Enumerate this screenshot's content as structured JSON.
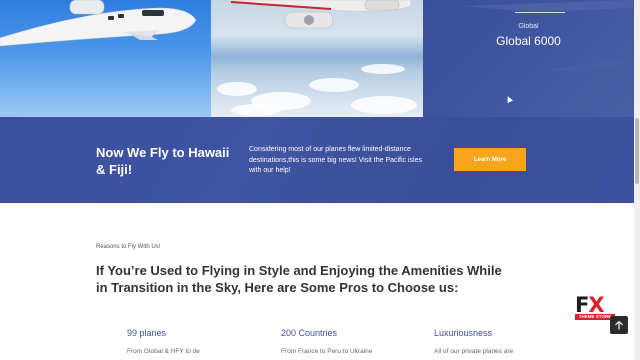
{
  "hero_panels": {
    "panel3_kicker": "Global",
    "panel3_title": "Global 6000"
  },
  "promo": {
    "heading": "Now We Fly to Hawaii & Fiji!",
    "text": "Considering most of our planes flew limited-distance destinations,this is some big news! Visit the Pacific isles with our help!",
    "button_label": "Learn More"
  },
  "reasons": {
    "kicker": "Reasons to Fly With Us!",
    "heading": "If You’re Used to Flying in Style and Enjoying the Amenities While in Transition in the Sky, Here are Some Pros to Choose us:",
    "features": [
      {
        "title": "99 planes",
        "desc": "From Global & HFY to de"
      },
      {
        "title": "200 Countries",
        "desc": "From France to Peru to Ukraine"
      },
      {
        "title": "Luxuriousness",
        "desc": "All of our private planes are"
      }
    ]
  },
  "logo": {
    "letters_f": "F",
    "letters_x": "X",
    "tagline": "THEME STORE"
  },
  "icons": {
    "back_to_top": "arrow-up-icon"
  },
  "colors": {
    "promo_bg": "#3c4f9e",
    "button_bg": "#f7a51c",
    "accent_text": "#3b4f9d"
  }
}
